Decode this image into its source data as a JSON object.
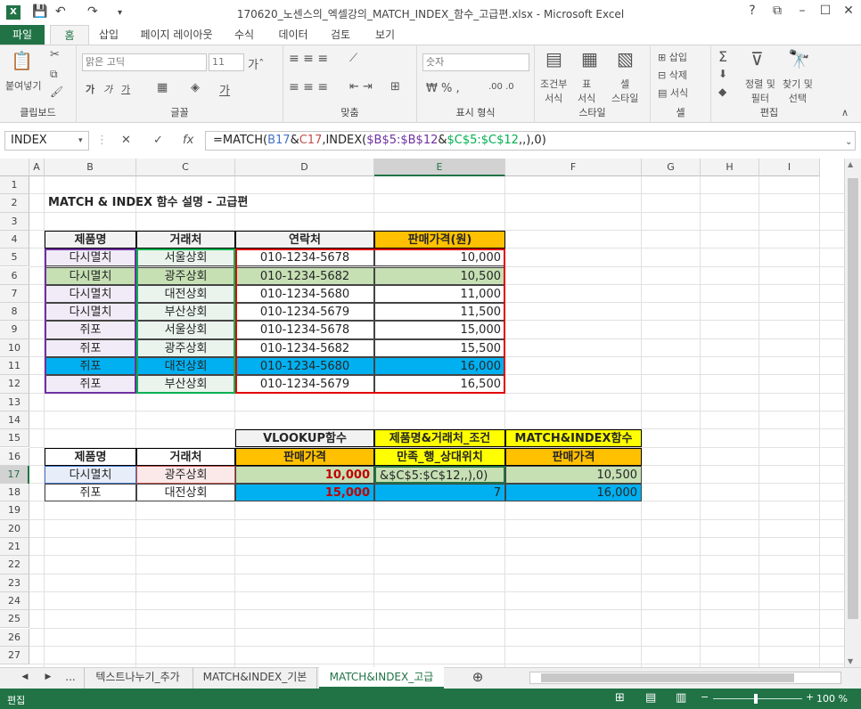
{
  "window": {
    "title": "170620_노센스의_엑셀강의_MATCH_INDEX_함수_고급편.xlsx - Microsoft Excel",
    "help": "?",
    "buttons": [
      "?",
      "⧉",
      "–",
      "☐",
      "✕"
    ]
  },
  "ribbon": {
    "tabs": [
      "파일",
      "홈",
      "삽입",
      "페이지 레이아웃",
      "수식",
      "데이터",
      "검토",
      "보기"
    ],
    "clipboard": {
      "paste": "붙여넣기",
      "label": "클립보드"
    },
    "font": {
      "name": "맑은 고딕",
      "size": "11",
      "bold": "가",
      "italic": "가",
      "underline": "가",
      "label": "글꼴"
    },
    "align": {
      "label": "맞춤"
    },
    "number": {
      "format": "숫자",
      "label": "표시 형식"
    },
    "styles": {
      "cond": "조건부\n서식",
      "table": "표\n서식",
      "cell": "셀\n스타일",
      "label": "스타일"
    },
    "cells": {
      "insert": "삽입",
      "delete": "삭제",
      "format": "서식",
      "label": "셀"
    },
    "editing": {
      "sort": "정렬 및\n필터",
      "find": "찾기 및\n선택",
      "label": "편집"
    }
  },
  "formula_bar": {
    "namebox": "INDEX",
    "formula_parts": [
      {
        "t": "=MATCH(",
        "c": "#262626"
      },
      {
        "t": "B17",
        "c": "#4472c4"
      },
      {
        "t": "&",
        "c": "#262626"
      },
      {
        "t": "C17",
        "c": "#c0504d"
      },
      {
        "t": ",INDEX(",
        "c": "#262626"
      },
      {
        "t": "$B$5:$B$12",
        "c": "#7030a0"
      },
      {
        "t": "&",
        "c": "#262626"
      },
      {
        "t": "$C$5:$C$12",
        "c": "#00b050"
      },
      {
        "t": ",,),0)",
        "c": "#262626"
      }
    ]
  },
  "columns": [
    "A",
    "B",
    "C",
    "D",
    "E",
    "F",
    "G",
    "H",
    "I"
  ],
  "rows": [
    "1",
    "2",
    "3",
    "4",
    "5",
    "6",
    "7",
    "8",
    "9",
    "10",
    "11",
    "12",
    "13",
    "14",
    "15",
    "16",
    "17",
    "18",
    "19",
    "20",
    "21",
    "22",
    "23",
    "24",
    "25",
    "26",
    "27"
  ],
  "sheet": {
    "heading": "MATCH & INDEX 함수 설명 - 고급편",
    "table1": {
      "headers": [
        "제품명",
        "거래처",
        "연락처",
        "판매가격(원)"
      ],
      "rows": [
        [
          "다시멸치",
          "서울상회",
          "010-1234-5678",
          "10,000"
        ],
        [
          "다시멸치",
          "광주상회",
          "010-1234-5682",
          "10,500"
        ],
        [
          "다시멸치",
          "대전상회",
          "010-1234-5680",
          "11,000"
        ],
        [
          "다시멸치",
          "부산상회",
          "010-1234-5679",
          "11,500"
        ],
        [
          "쥐포",
          "서울상회",
          "010-1234-5678",
          "15,000"
        ],
        [
          "쥐포",
          "광주상회",
          "010-1234-5682",
          "15,500"
        ],
        [
          "쥐포",
          "대전상회",
          "010-1234-5680",
          "16,000"
        ],
        [
          "쥐포",
          "부산상회",
          "010-1234-5679",
          "16,500"
        ]
      ]
    },
    "table2": {
      "top_headers": [
        "VLOOKUP함수",
        "제품명&거래처_조건",
        "MATCH&INDEX함수"
      ],
      "headers": [
        "제품명",
        "거래처",
        "판매가격",
        "만족_행_상대위치",
        "판매가격"
      ],
      "rows": [
        [
          "다시멸치",
          "광주상회",
          "10,000",
          "&$C$5:$C$12,,),0)",
          "10,500"
        ],
        [
          "쥐포",
          "대전상회",
          "15,000",
          "7",
          "16,000"
        ]
      ]
    }
  },
  "sheet_tabs": [
    "...",
    "텍스트나누기_추가",
    "MATCH&INDEX_기본",
    "MATCH&INDEX_고급"
  ],
  "status": {
    "mode": "편집",
    "zoom": "100 %"
  },
  "colors": {
    "accent": "#217346",
    "orange": "#ffc000",
    "yellow": "#ffff00",
    "blue": "#00b0f0",
    "green_row": "#c6e0b4",
    "red_text": "#c00000"
  }
}
